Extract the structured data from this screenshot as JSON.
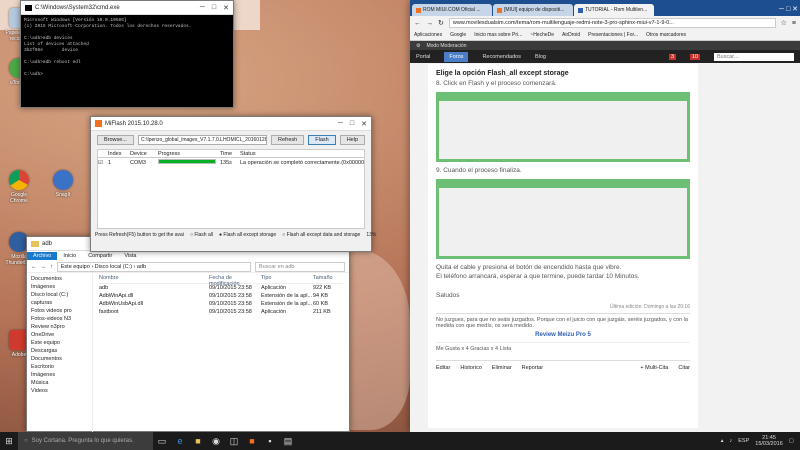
{
  "desktop": {
    "icons": [
      {
        "label": "Papelera de reciclaje",
        "icon": "recycle-bin-icon",
        "color": "#b5c9de"
      },
      {
        "label": "uTorrent",
        "icon": "utorrent-icon",
        "color": "#4ca946"
      },
      {
        "label": "Google Chrome",
        "icon": "chrome-icon",
        "color": "#e2c13a"
      },
      {
        "label": "SnagIt",
        "icon": "snagit-icon",
        "color": "#3b72c5"
      },
      {
        "label": "Mozilla Thunderbird",
        "icon": "thunderbird-icon",
        "color": "#2f5f9e"
      },
      {
        "label": "Adobe",
        "icon": "adobe-icon",
        "color": "#d03a2e"
      }
    ]
  },
  "cmd": {
    "title": "C:\\Windows\\System32\\cmd.exe",
    "lines": [
      "Microsoft Windows [Versión 10.0.10586]",
      "(c) 2015 Microsoft Corporation. Todos los derechos reservados.",
      "",
      "C:\\adb>adb devices",
      "List of devices attached",
      "3b2f06e       device",
      "",
      "C:\\adb>adb reboot edl",
      "",
      "C:\\adb>"
    ]
  },
  "miflash": {
    "title": "MiFlash 2015.10.28.0",
    "browse_label": "Browse...",
    "path_value": "C:\\Ipenzo_global_images_V7.1.7.0.LHOMICL_20160128.000",
    "refresh_label": "Refresh",
    "flash_label": "Flash",
    "help_label": "Help",
    "columns": [
      "Index",
      "Device",
      "Progress",
      "Time",
      "Status"
    ],
    "rows": [
      {
        "index": "1",
        "device": "COM3",
        "progress": 1.0,
        "time": "135s",
        "status": "La operación se completó correctamente.(0x000000..."
      }
    ],
    "footer_hint": "Press Refresh(F5) button to get the avai",
    "options": [
      "Flash all",
      "Flash all except storage",
      "Flash all except data and storage"
    ],
    "selected_option": 1,
    "footer_percent": "13%"
  },
  "explorer": {
    "title": "adb",
    "ribbon_tabs": [
      "Archivo",
      "Inicio",
      "Compartir",
      "Vista"
    ],
    "breadcrumb": "Este equipo › Disco local (C:) › adb",
    "search_placeholder": "Buscar en adb",
    "columns": [
      "Nombre",
      "Fecha de modificación",
      "Tipo",
      "Tamaño"
    ],
    "files": [
      {
        "name": "adb",
        "date": "09/10/2015 23:58",
        "type": "Aplicación",
        "size": "922 KB"
      },
      {
        "name": "AdbWinApi.dll",
        "date": "09/10/2015 23:58",
        "type": "Extensión de la apl...",
        "size": "94 KB"
      },
      {
        "name": "AdbWinUsbApi.dll",
        "date": "09/10/2015 23:58",
        "type": "Extensión de la apl...",
        "size": "60 KB"
      },
      {
        "name": "fastboot",
        "date": "09/10/2015 23:58",
        "type": "Aplicación",
        "size": "211 KB"
      }
    ],
    "nav": [
      "Documentos",
      "Imágenes",
      "Disco local (C:)",
      "capturas",
      "Fotos videos pro",
      "Fotos-videos N3",
      "Review n3pro",
      "OneDrive",
      "Este equipo",
      "Descargas",
      "Documentos",
      "Escritorio",
      "Imágenes",
      "Música",
      "Videos"
    ]
  },
  "chrome": {
    "tabs": [
      {
        "label": "ROM MIUI.COM Oficial ..."
      },
      {
        "label": "[MIUI] equipo de dispositi..."
      },
      {
        "label": "TUTORIAL - Rom Multilen..."
      }
    ],
    "active_tab": 2,
    "url": "www.movilesdualsim.com/tema/rom-multilenguaje-redmi-note-3-pro-sphinx-miui-v7-1-9-0...",
    "bookmarks": [
      "Aplicaciones",
      "Google",
      "Inicio mas sobre Pri...",
      "~HecheDe",
      "AirDroid",
      "Presentaciones | For...",
      "Otros marcadores"
    ],
    "mod_label": "Modo Moderación",
    "nav": [
      "Portal",
      "Foros",
      "Recomendados",
      "Blog"
    ],
    "active_nav": 1,
    "notify": [
      "3",
      "10"
    ],
    "search_placeholder": "Buscar...",
    "heading": "Elige la opción Flash_all except storage",
    "step8": "8. Click en Flash y el proceso comenzará.",
    "step9": "9. Cuando el proceso finaliza.",
    "after1": "Quita el cable y presiona el botón de encendido hasta que vibre.",
    "after2": "El teléfono arrancará, esperar a que termine, puede tardar 10 Minutos.",
    "greeting": "Saludos",
    "edited": "Última edición: Domingo a las 20:16",
    "quote": "No juzgues, para que no seáis juzgados. Porque con el juicio con que juzgáis, seréis juzgados, y con la medida con que medís, os será medido.",
    "review_link": "Review Meizu Pro 5",
    "likes_text": "Me Gusta x 4   Gracias x 4   Lista",
    "actions": [
      "Editar",
      "Historico",
      "Eliminar",
      "Reportar"
    ],
    "reply_buttons": [
      "+ Multi-Cita",
      "Citar"
    ]
  },
  "taskbar": {
    "search_placeholder": "Soy Cortana. Pregunta lo que quieras.",
    "time": "21:45",
    "date": "15/03/2016",
    "lang": "ESP"
  }
}
